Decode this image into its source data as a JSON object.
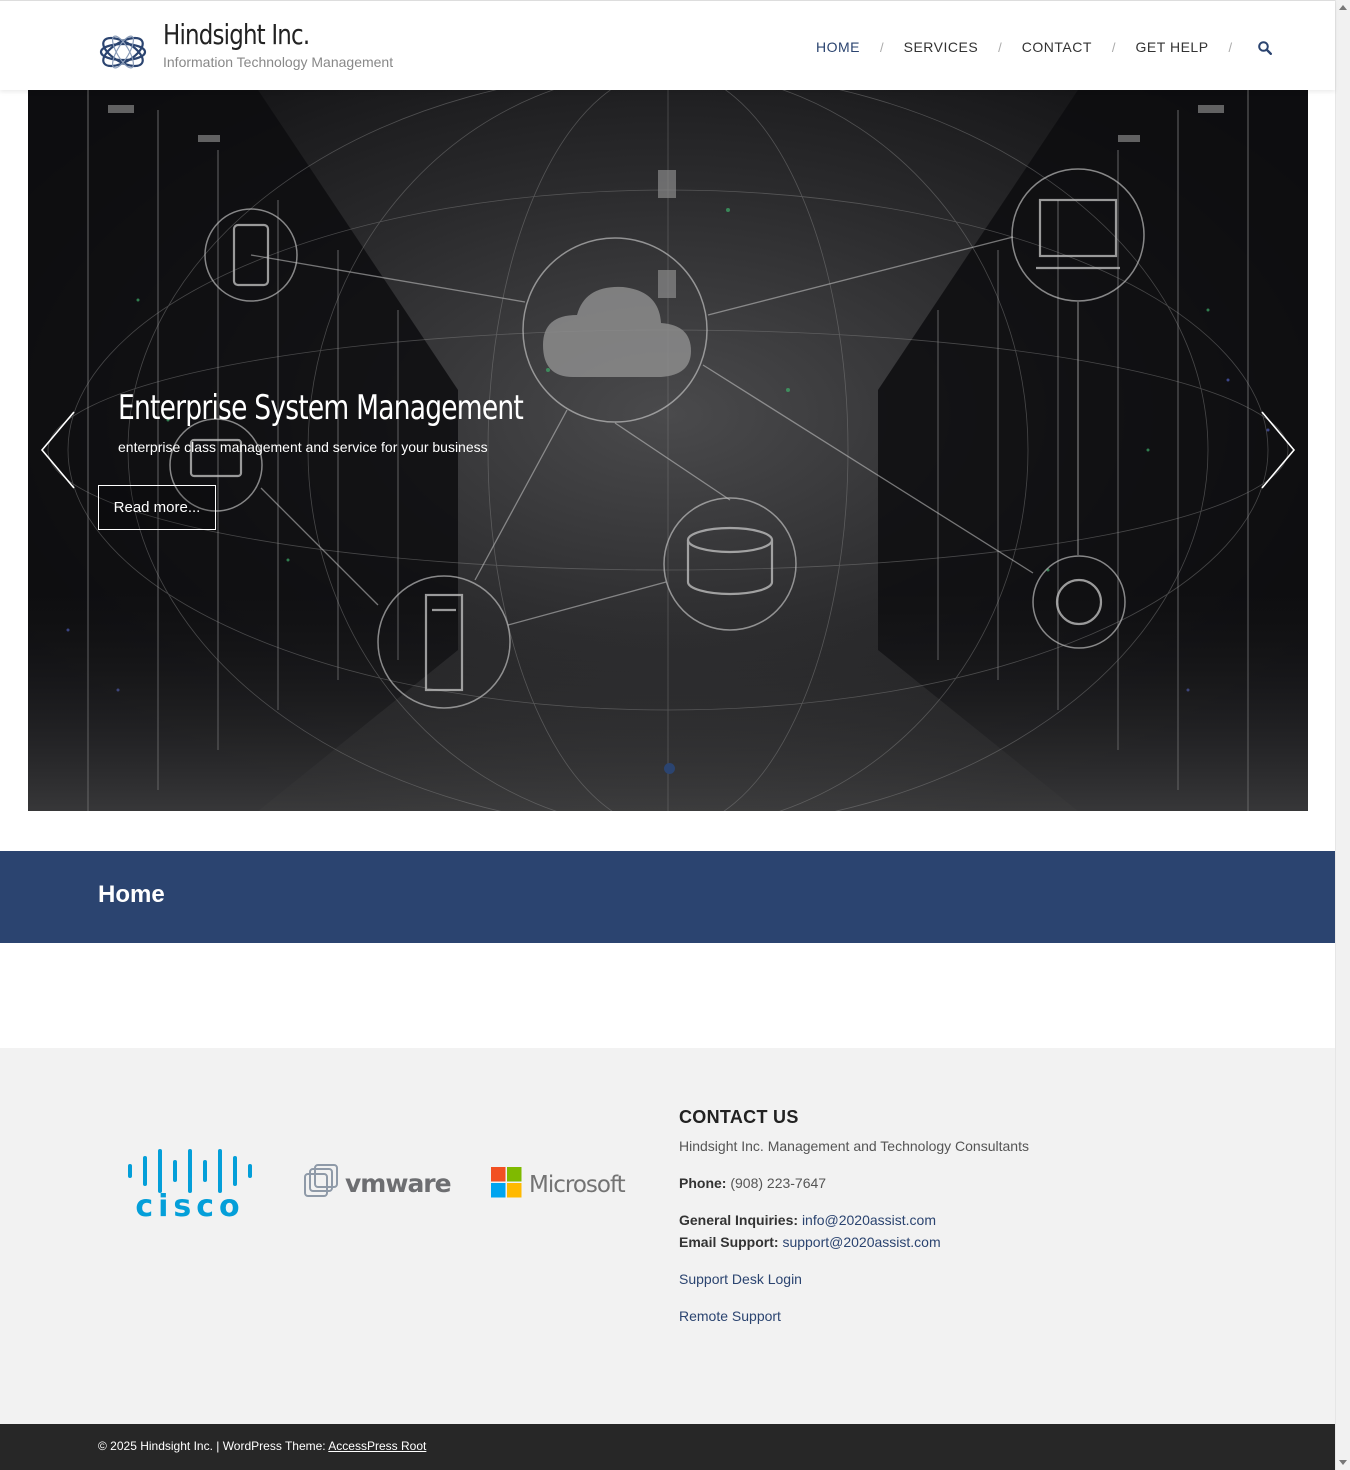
{
  "header": {
    "site_title": "Hindsight Inc.",
    "tagline": "Information Technology Management",
    "nav": [
      {
        "label": "HOME"
      },
      {
        "label": "SERVICES"
      },
      {
        "label": "CONTACT"
      },
      {
        "label": "GET HELP"
      }
    ],
    "nav_separator": "/",
    "search_icon": "search-icon"
  },
  "slider": {
    "title": "Enterprise System Management",
    "text": "enterprise class management and service for your business",
    "button": "Read more...",
    "prev_icon": "chevron-left-icon",
    "next_icon": "chevron-right-icon",
    "active_slide": 1
  },
  "page": {
    "title": "Home"
  },
  "partners": [
    "cisco",
    "vmware",
    "Microsoft"
  ],
  "contact": {
    "heading": "CONTACT US",
    "company": "Hindsight Inc. Management and Technology Consultants",
    "phone_label": "Phone:",
    "phone": "(908) 223-7647",
    "general_label": "General Inquiries:",
    "general_email": "info@2020assist.com",
    "support_label": "Email Support:",
    "support_email": "support@2020assist.com",
    "support_login": "Support Desk Login",
    "remote_support": "Remote Support"
  },
  "footer": {
    "copyright": "© 2025 Hindsight Inc. | WordPress Theme: ",
    "theme_link": "AccessPress Root"
  },
  "colors": {
    "brand": "#2b4470",
    "footer_bg": "#f2f2f2",
    "bottom_bar": "#272727",
    "cisco": "#049fd9"
  }
}
